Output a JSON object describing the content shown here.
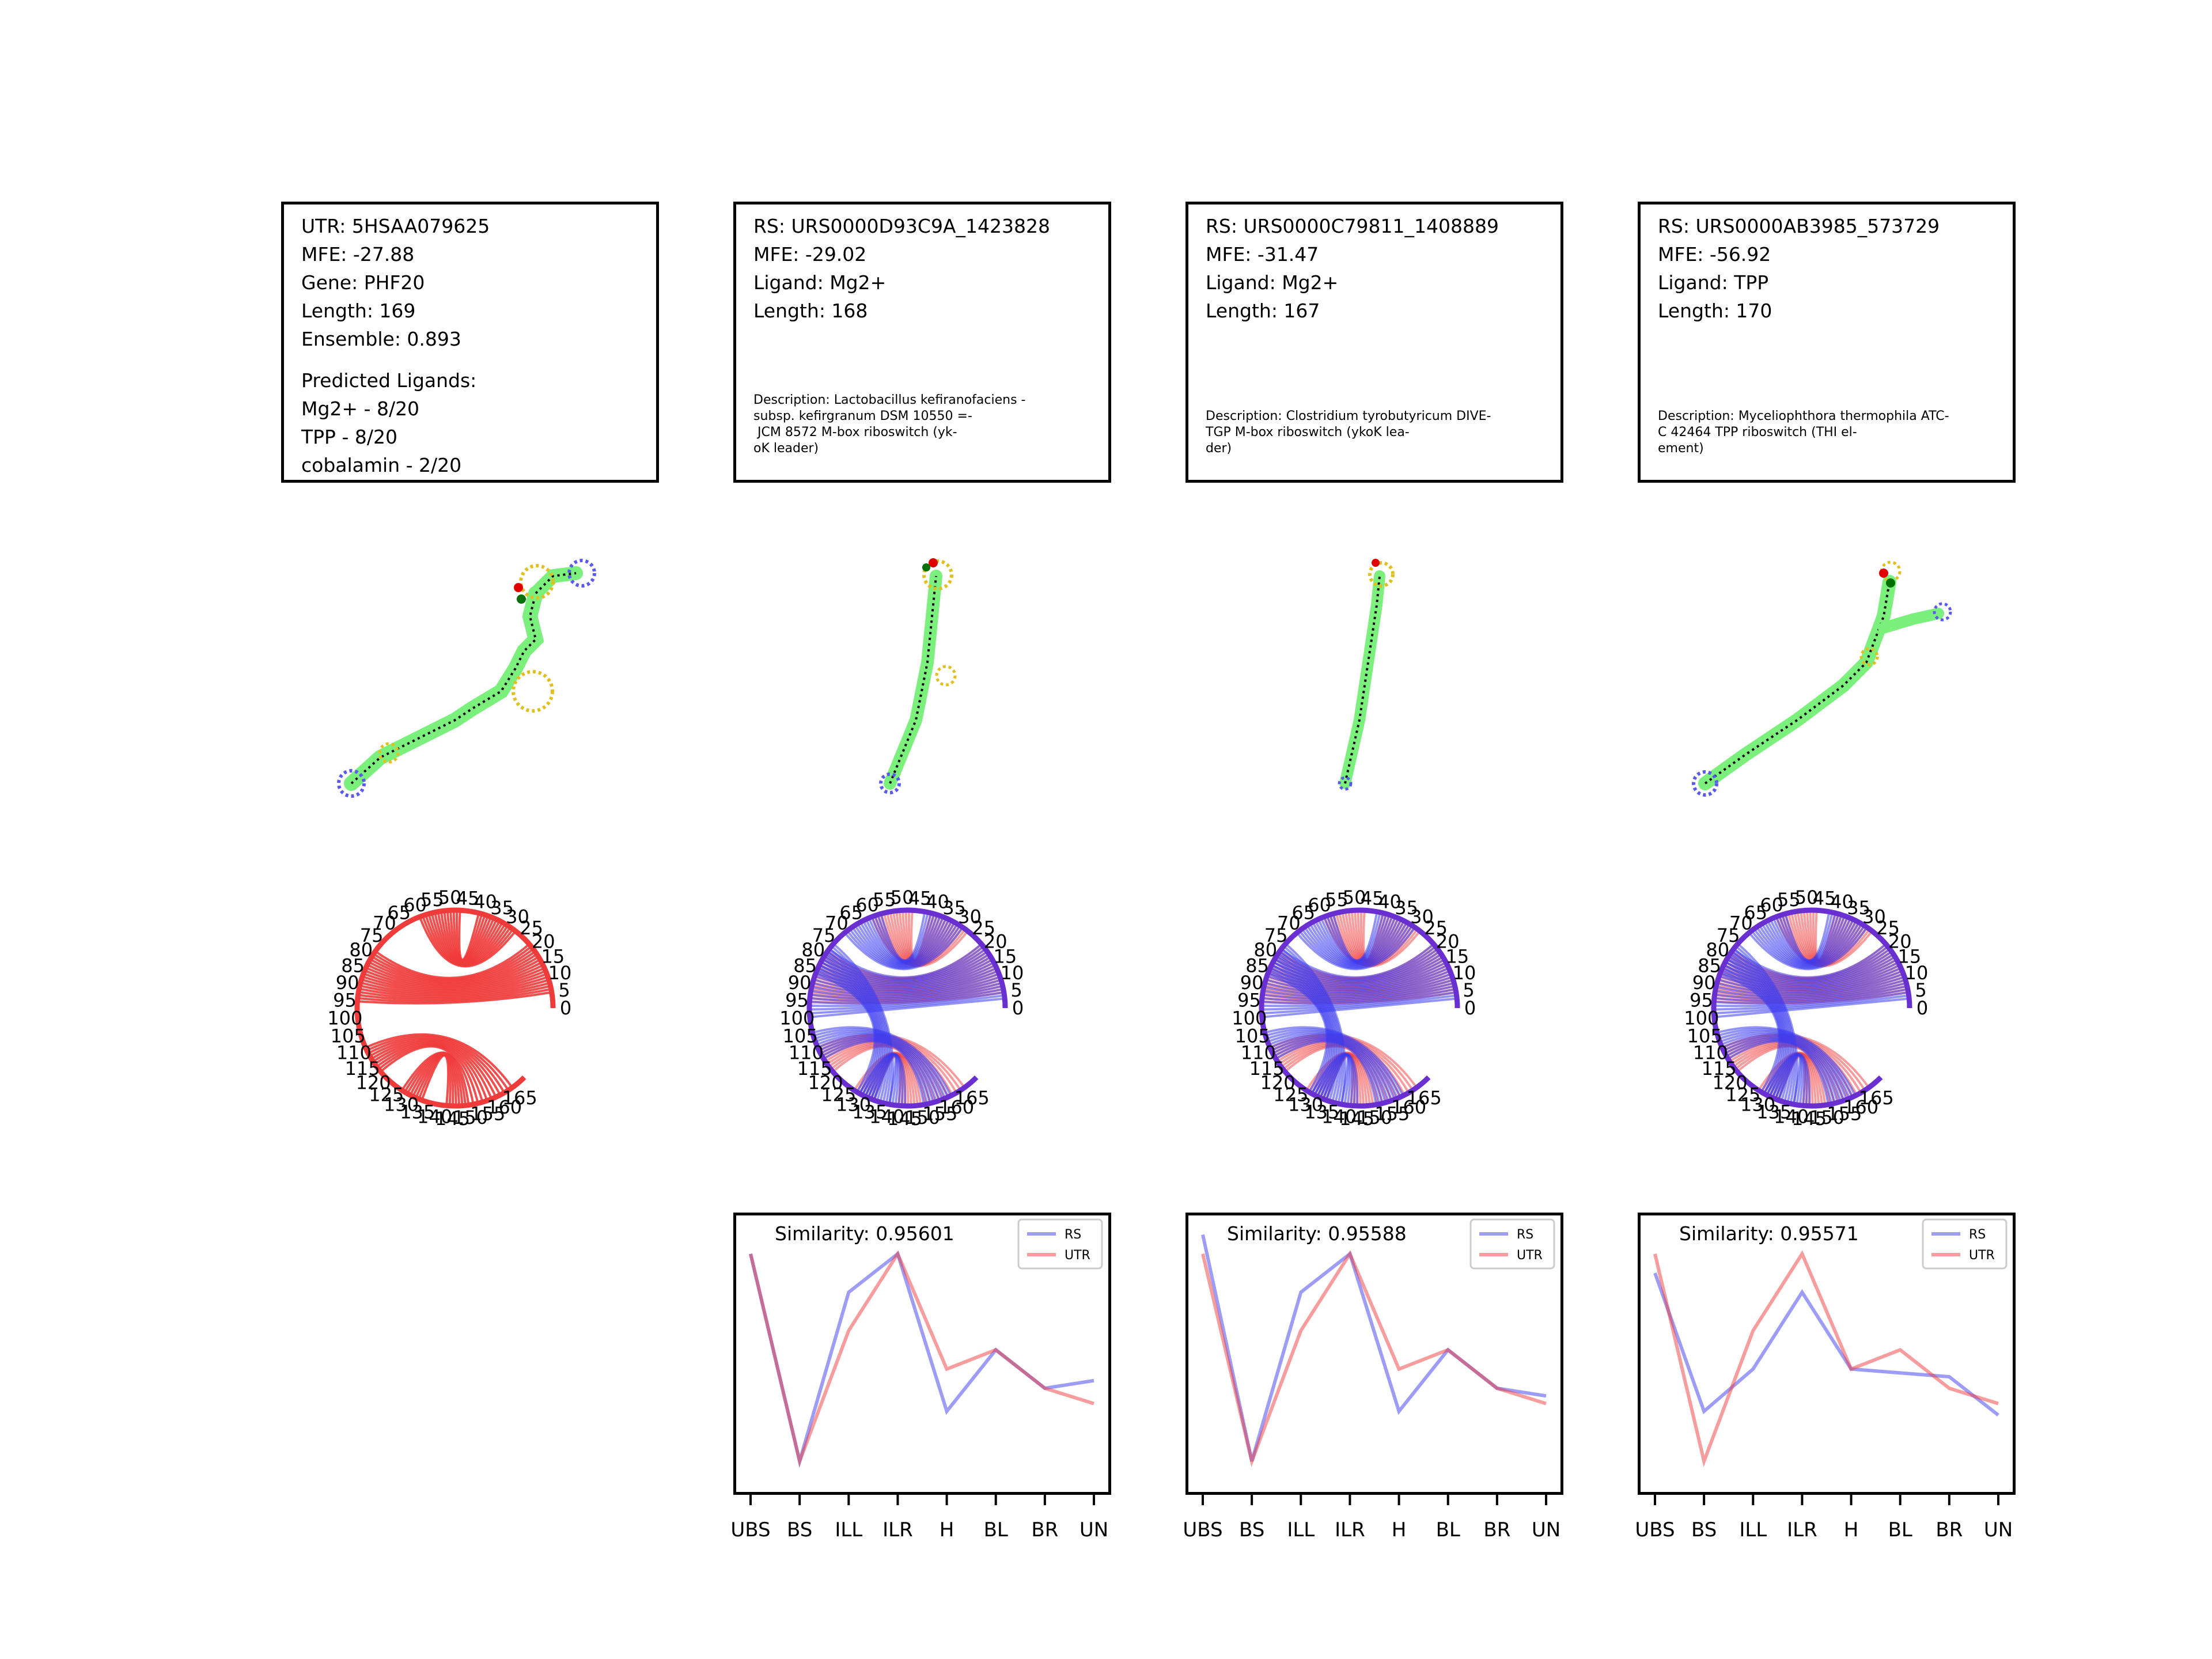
{
  "info_boxes": [
    {
      "lines": [
        "UTR: 5HSAA079625",
        "MFE: -27.88",
        "Gene: PHF20",
        "Length: 169",
        "Ensemble: 0.893"
      ],
      "extra_lines": [
        "Predicted Ligands:",
        "Mg2+ - 8/20",
        "TPP - 8/20",
        "cobalamin - 2/20"
      ],
      "description": ""
    },
    {
      "lines": [
        "RS: URS0000D93C9A_1423828",
        "MFE: -29.02",
        "Ligand: Mg2+",
        "Length: 168"
      ],
      "extra_lines": [],
      "description": "Description: Lactobacillus kefiranofaciens -\nsubsp. kefirgranum DSM 10550 =-\n JCM 8572 M-box riboswitch (yk-\noK leader)"
    },
    {
      "lines": [
        "RS: URS0000C79811_1408889",
        "MFE: -31.47",
        "Ligand: Mg2+",
        "Length: 167"
      ],
      "extra_lines": [],
      "description": "Description: Clostridium tyrobutyricum DIVE-\nTGP M-box riboswitch (ykoK lea-\nder)"
    },
    {
      "lines": [
        "RS: URS0000AB3985_573729",
        "MFE: -56.92",
        "Ligand: TPP",
        "Length: 170"
      ],
      "extra_lines": [],
      "description": "Description: Myceliophthora thermophila ATC-\nC 42464 TPP riboswitch (THI el-\nement)"
    }
  ],
  "chord_labels": [
    "0",
    "5",
    "10",
    "15",
    "20",
    "25",
    "30",
    "35",
    "40",
    "45",
    "50",
    "55",
    "60",
    "65",
    "70",
    "75",
    "80",
    "85",
    "90",
    "95",
    "100",
    "105",
    "110",
    "115",
    "120",
    "125",
    "130",
    "135",
    "140",
    "145",
    "150",
    "155",
    "160",
    "165"
  ],
  "colors": {
    "rs": "#3b3bf0",
    "utr": "#f03b3b",
    "stem": "#7cf07c",
    "loop_blue": "#5a5af0",
    "loop_yellow": "#e0c020",
    "red_dot": "#e00000",
    "green_dot": "#007000"
  },
  "chart_data": [
    {
      "type": "line",
      "title": "Similarity: 0.95601",
      "categories": [
        "UBS",
        "BS",
        "ILL",
        "ILR",
        "H",
        "BL",
        "BR",
        "UN"
      ],
      "series": [
        {
          "name": "RS",
          "values": [
            0.62,
            0.08,
            0.52,
            0.62,
            0.21,
            0.37,
            0.27,
            0.29
          ]
        },
        {
          "name": "UTR",
          "values": [
            0.62,
            0.08,
            0.42,
            0.62,
            0.32,
            0.37,
            0.27,
            0.23
          ]
        }
      ],
      "ylim": [
        0,
        0.72
      ]
    },
    {
      "type": "line",
      "title": "Similarity: 0.95588",
      "categories": [
        "UBS",
        "BS",
        "ILL",
        "ILR",
        "H",
        "BL",
        "BR",
        "UN"
      ],
      "series": [
        {
          "name": "RS",
          "values": [
            0.67,
            0.08,
            0.52,
            0.62,
            0.21,
            0.37,
            0.27,
            0.25
          ]
        },
        {
          "name": "UTR",
          "values": [
            0.62,
            0.08,
            0.42,
            0.62,
            0.32,
            0.37,
            0.27,
            0.23
          ]
        }
      ],
      "ylim": [
        0,
        0.72
      ]
    },
    {
      "type": "line",
      "title": "Similarity: 0.95571",
      "categories": [
        "UBS",
        "BS",
        "ILL",
        "ILR",
        "H",
        "BL",
        "BR",
        "UN"
      ],
      "series": [
        {
          "name": "RS",
          "values": [
            0.57,
            0.21,
            0.32,
            0.52,
            0.32,
            0.31,
            0.3,
            0.2
          ]
        },
        {
          "name": "UTR",
          "values": [
            0.62,
            0.08,
            0.42,
            0.62,
            0.32,
            0.37,
            0.27,
            0.23
          ]
        }
      ],
      "ylim": [
        0,
        0.72
      ]
    }
  ]
}
